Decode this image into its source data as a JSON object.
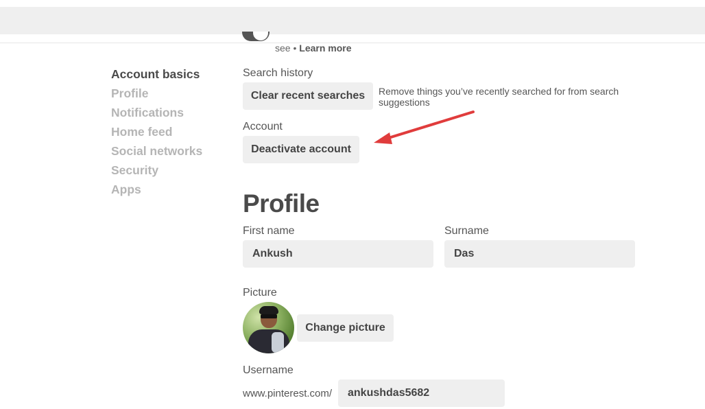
{
  "sidebar": {
    "items": [
      {
        "label": "Account basics",
        "active": true
      },
      {
        "label": "Profile"
      },
      {
        "label": "Notifications"
      },
      {
        "label": "Home feed"
      },
      {
        "label": "Social networks"
      },
      {
        "label": "Security"
      },
      {
        "label": "Apps"
      }
    ]
  },
  "top_partial": {
    "text": "see",
    "separator": "•",
    "link": "Learn more"
  },
  "search_history": {
    "label": "Search history",
    "button": "Clear recent searches",
    "description": "Remove things you’ve recently searched for from search suggestions"
  },
  "account": {
    "label": "Account",
    "button": "Deactivate account"
  },
  "annotation": {
    "type": "arrow",
    "color": "#e03c3c",
    "points_to": "Deactivate account"
  },
  "profile": {
    "heading": "Profile",
    "first_name": {
      "label": "First name",
      "value": "Ankush"
    },
    "surname": {
      "label": "Surname",
      "value": "Das"
    },
    "picture": {
      "label": "Picture",
      "button": "Change picture"
    },
    "username": {
      "label": "Username",
      "prefix": "www.pinterest.com/",
      "value": "ankushdas5682"
    }
  }
}
